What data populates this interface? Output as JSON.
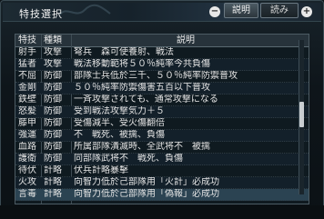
{
  "window": {
    "title": "特技選択"
  },
  "header": {
    "minus_symbol": "−",
    "tab_explain": "説明",
    "tab_read": "読み",
    "plus_symbol": "+"
  },
  "table": {
    "headers": [
      "特技",
      "種類",
      "説明"
    ],
    "rows": [
      [
        "射手",
        "攻撃",
        "弩兵　森可使養射、戦法"
      ],
      [
        "猛者",
        "攻撃",
        "戦法移動範将５０％純率今共負傷"
      ],
      [
        "不屈",
        "防御",
        "部隊士兵低於三千、５０％純率防禦普攻"
      ],
      [
        "金剛",
        "防御",
        "５０％純率防禦傷害五百以下普攻"
      ],
      [
        "鉄壁",
        "防御",
        "一斉攻撃されても、通常攻撃になる"
      ],
      [
        "怒髪",
        "防御",
        "受到戦法攻撃気力＋５"
      ],
      [
        "藤甲",
        "防御",
        "受傷減半、受火傷翻倍"
      ],
      [
        "強運",
        "防御",
        "不　戦死、被擒、負傷"
      ],
      [
        "血路",
        "防御",
        "所属部隊潰滅時、全武将不　被擒"
      ],
      [
        "護衛",
        "防御",
        "同部隊武将不　戦死、負傷"
      ],
      [
        "待伏",
        "計略",
        "伏兵計略暴擊"
      ],
      [
        "火攻",
        "計略",
        "向智力低於己部隊用「火計」必成功"
      ],
      [
        "言毒",
        "計略",
        "向智力低於己部隊用「偽報」必成功"
      ]
    ]
  },
  "colors": {
    "background": "#0d1318",
    "header": "#27333b",
    "selected_row": "#2b4352"
  },
  "icons": {
    "decor": "dragon-ornament-icon",
    "scroll": "scrollbar-thumb"
  }
}
